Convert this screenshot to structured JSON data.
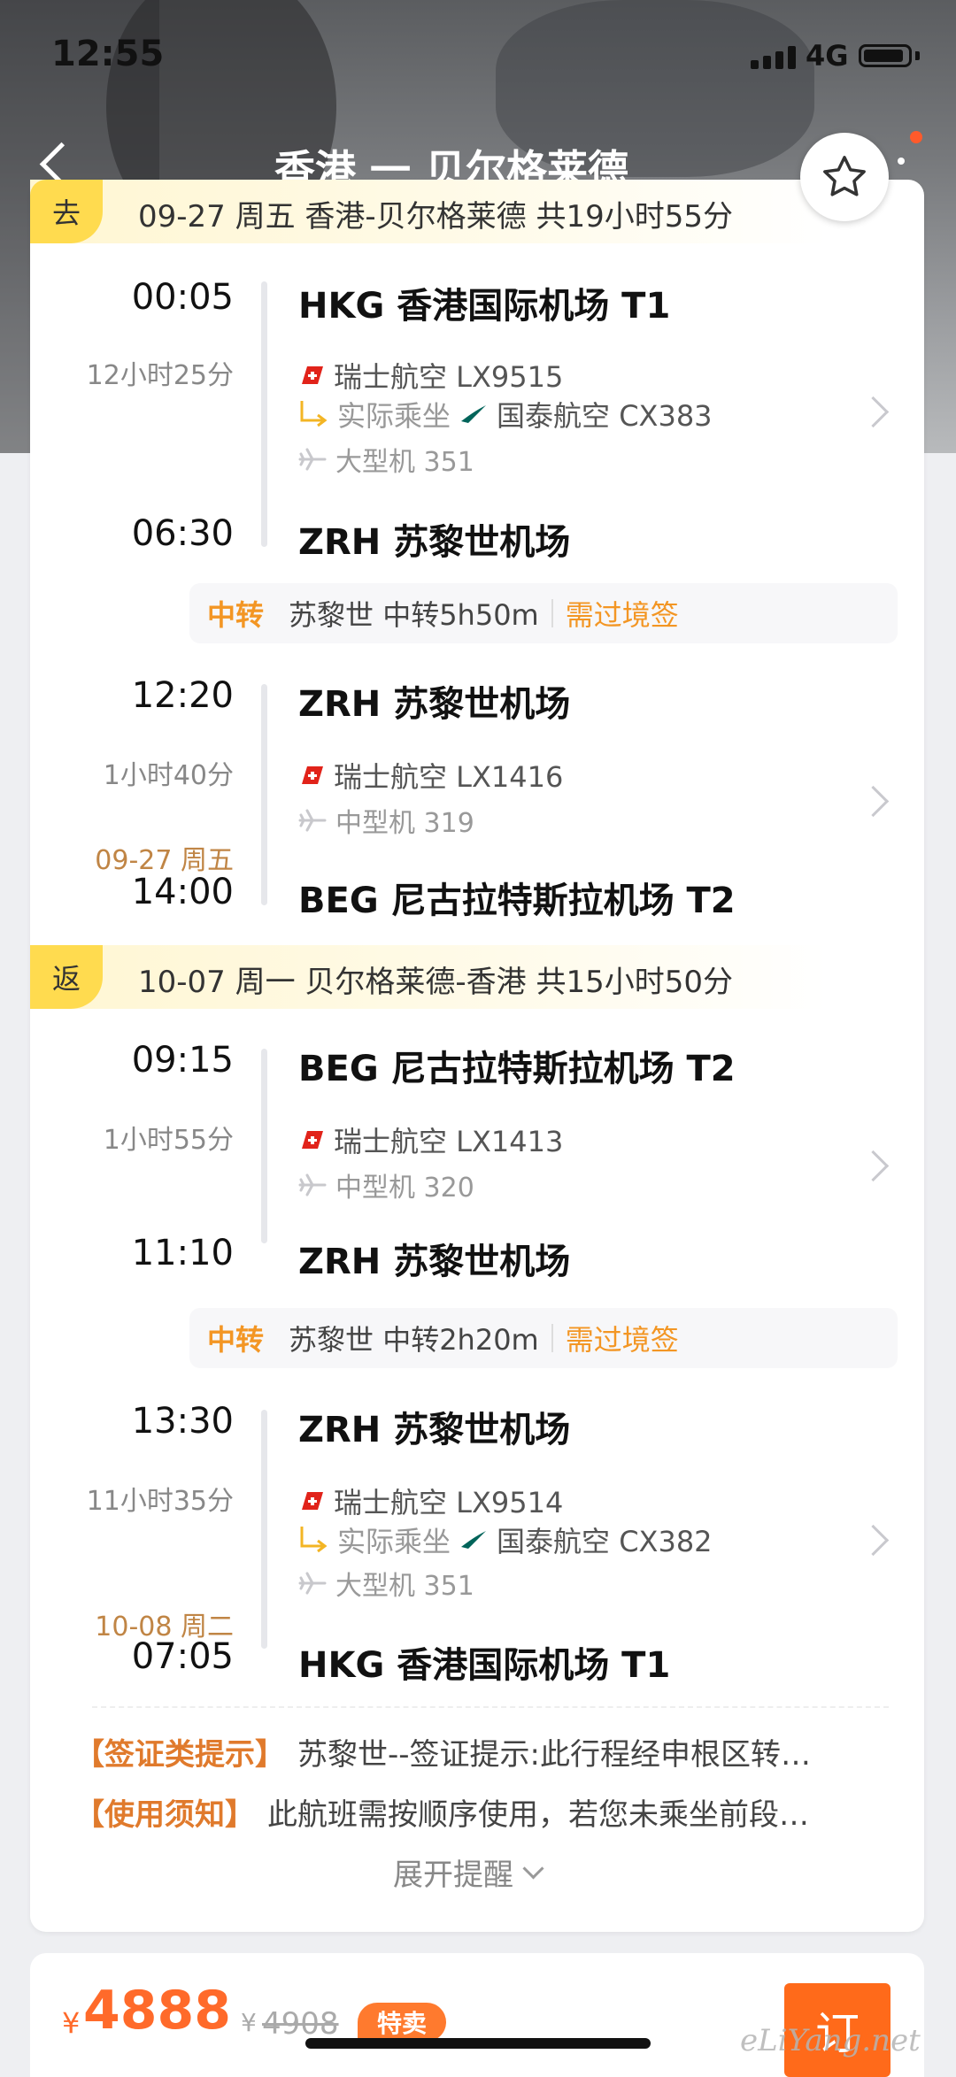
{
  "status_bar": {
    "time": "12:55",
    "network": "4G"
  },
  "header": {
    "title": "香港 一 贝尔格莱德"
  },
  "outbound": {
    "tag": "去",
    "summary": "09-27 周五 香港-贝尔格莱德 共19小时55分",
    "flights": [
      {
        "dep_time": "00:05",
        "dep_airport": "HKG 香港国际机场 T1",
        "duration": "12小时25分",
        "airline": "瑞士航空 LX9515",
        "actual_label": "实际乘坐",
        "actual_airline": "国泰航空 CX383",
        "aircraft": "大型机 351",
        "arr_time": "06:30",
        "arr_airport": "ZRH 苏黎世机场"
      },
      {
        "dep_time": "12:20",
        "dep_airport": "ZRH 苏黎世机场",
        "duration": "1小时40分",
        "airline": "瑞士航空 LX1416",
        "aircraft": "中型机 319",
        "arr_date": "09-27 周五",
        "arr_time": "14:00",
        "arr_airport": "BEG 尼古拉特斯拉机场 T2"
      }
    ],
    "transfer": {
      "label": "中转",
      "detail": "苏黎世 中转5h50m",
      "visa": "需过境签"
    }
  },
  "return": {
    "tag": "返",
    "summary": "10-07 周一 贝尔格莱德-香港 共15小时50分",
    "flights": [
      {
        "dep_time": "09:15",
        "dep_airport": "BEG 尼古拉特斯拉机场 T2",
        "duration": "1小时55分",
        "airline": "瑞士航空 LX1413",
        "aircraft": "中型机 320",
        "arr_time": "11:10",
        "arr_airport": "ZRH 苏黎世机场"
      },
      {
        "dep_time": "13:30",
        "dep_airport": "ZRH 苏黎世机场",
        "duration": "11小时35分",
        "airline": "瑞士航空 LX9514",
        "actual_label": "实际乘坐",
        "actual_airline": "国泰航空 CX382",
        "aircraft": "大型机 351",
        "arr_date": "10-08 周二",
        "arr_time": "07:05",
        "arr_airport": "HKG 香港国际机场 T1"
      }
    ],
    "transfer": {
      "label": "中转",
      "detail": "苏黎世 中转2h20m",
      "visa": "需过境签"
    }
  },
  "notices": [
    {
      "key": "【签证类提示】",
      "value": "苏黎世--签证提示:此行程经申根区转…"
    },
    {
      "key": "【使用须知】",
      "value": "此航班需按顺序使用，若您未乘坐前段…"
    }
  ],
  "expand_label": "展开提醒",
  "footer": {
    "currency": "¥",
    "price": "4888",
    "old_currency": "¥",
    "old_price": "4908",
    "sale_badge": "特卖",
    "book_label": "订"
  },
  "watermark": "eLiYang.net",
  "colors": {
    "accent_orange": "#ff6a2a",
    "tag_yellow": "#ffdb4f",
    "swiss_red": "#e1231a",
    "cathay_green": "#00645a"
  }
}
